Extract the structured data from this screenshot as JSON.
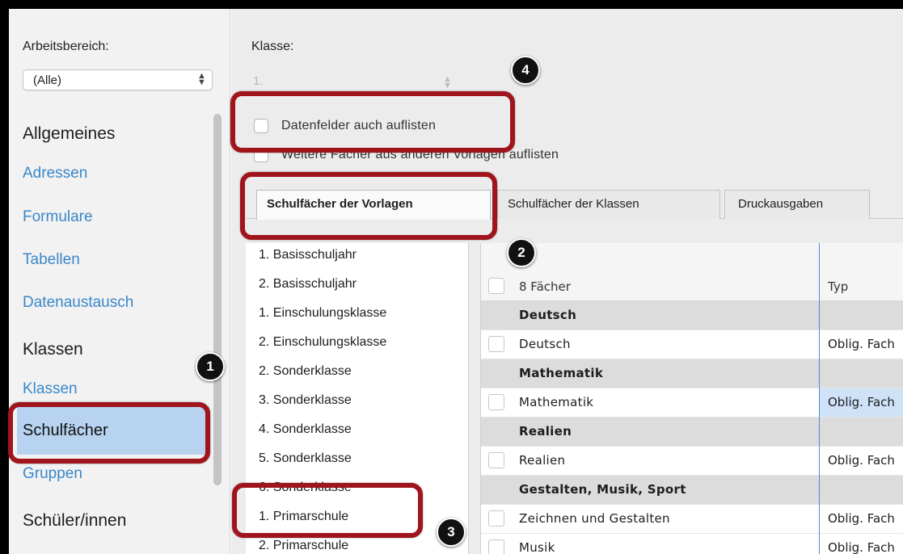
{
  "sidebar": {
    "workspace_label": "Arbeitsbereich:",
    "workspace_value": "(Alle)",
    "items": [
      {
        "label": "Allgemeines",
        "kind": "header"
      },
      {
        "label": "Adressen",
        "kind": "link"
      },
      {
        "label": "Formulare",
        "kind": "link"
      },
      {
        "label": "Tabellen",
        "kind": "link"
      },
      {
        "label": "Datenaustausch",
        "kind": "link"
      },
      {
        "label": "Klassen",
        "kind": "header"
      },
      {
        "label": "Klassen",
        "kind": "link"
      },
      {
        "label": "Schulfächer",
        "kind": "selected"
      },
      {
        "label": "Gruppen",
        "kind": "link"
      },
      {
        "label": "Schüler/innen",
        "kind": "header"
      }
    ]
  },
  "main": {
    "klasse_label": "Klasse:",
    "klasse_value": "1.",
    "checkbox_datenfelder": "Datenfelder auch auflisten",
    "checkbox_weitere": "Weitere Fächer aus anderen Vorlagen auflisten",
    "tabs": [
      {
        "label": "Schulfächer der Vorlagen",
        "active": true
      },
      {
        "label": "Schulfächer der Klassen",
        "active": false
      },
      {
        "label": "Druckausgaben",
        "active": false
      }
    ],
    "templates": [
      "1. Basisschuljahr",
      "2. Basisschuljahr",
      "1. Einschulungsklasse",
      "2. Einschulungsklasse",
      "2. Sonderklasse",
      "3. Sonderklasse",
      "4. Sonderklasse",
      "5. Sonderklasse",
      "6. Sonderklasse",
      "1. Primarschule",
      "2. Primarschule"
    ],
    "table": {
      "header_count": "8 Fächer",
      "header_type": "Typ",
      "rows": [
        {
          "name": "Deutsch",
          "type": "",
          "group": true
        },
        {
          "name": "Deutsch",
          "type": "Oblig. Fach",
          "group": false
        },
        {
          "name": "Mathematik",
          "type": "",
          "group": true
        },
        {
          "name": "Mathematik",
          "type": "Oblig. Fach",
          "group": false,
          "highlight": true
        },
        {
          "name": "Realien",
          "type": "",
          "group": true
        },
        {
          "name": "Realien",
          "type": "Oblig. Fach",
          "group": false
        },
        {
          "name": "Gestalten, Musik, Sport",
          "type": "",
          "group": true
        },
        {
          "name": "Zeichnen und Gestalten",
          "type": "Oblig. Fach",
          "group": false
        },
        {
          "name": "Musik",
          "type": "Oblig. Fach",
          "group": false
        }
      ]
    }
  },
  "annotations": {
    "badges": [
      "1",
      "2",
      "3",
      "4"
    ],
    "highlight_color": "#a0141c"
  },
  "colors": {
    "link": "#3a87c9",
    "selection": "#b7d3f0",
    "column_divider": "#4a90d9"
  }
}
